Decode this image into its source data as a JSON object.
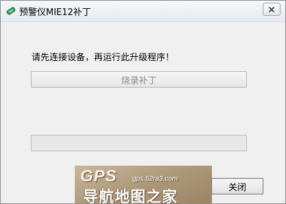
{
  "window": {
    "title": "预警仪MIE12补丁",
    "icon": "green-device-icon",
    "close_icon": "close-icon"
  },
  "prompt": "请先连接设备，再运行此升级程序！",
  "burn_button": {
    "label": "烧录补丁",
    "enabled": false
  },
  "progress": {
    "value": 0
  },
  "watermark": {
    "brand": "GPS",
    "site": "gps.52ra3.com",
    "name": "导航地图之家"
  },
  "close_button": {
    "label": "关闭"
  },
  "colors": {
    "window_bg": "#f0f0f0",
    "disabled_text": "#8c8c8c",
    "progress_fill": "#06b025"
  }
}
